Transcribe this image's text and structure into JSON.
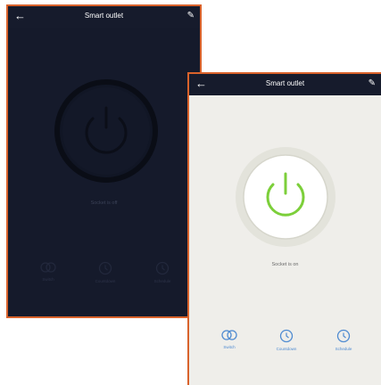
{
  "screen_off": {
    "title": "Smart outlet",
    "status": "Socket is off",
    "nav": [
      {
        "label": "Switch",
        "icon": "switch-icon"
      },
      {
        "label": "Countdown",
        "icon": "clock-icon"
      },
      {
        "label": "Schedule",
        "icon": "clock-icon"
      }
    ]
  },
  "screen_on": {
    "title": "Smart outlet",
    "status": "Socket is on",
    "nav": [
      {
        "label": "Switch",
        "icon": "switch-icon"
      },
      {
        "label": "Countdown",
        "icon": "clock-icon"
      },
      {
        "label": "Schedule",
        "icon": "clock-icon"
      }
    ]
  },
  "colors": {
    "frame_border": "#d9622b",
    "dark_bg": "#151a2b",
    "light_bg": "#efeeea",
    "power_on": "#7ccf3a",
    "nav_accent": "#4f8bd1"
  }
}
